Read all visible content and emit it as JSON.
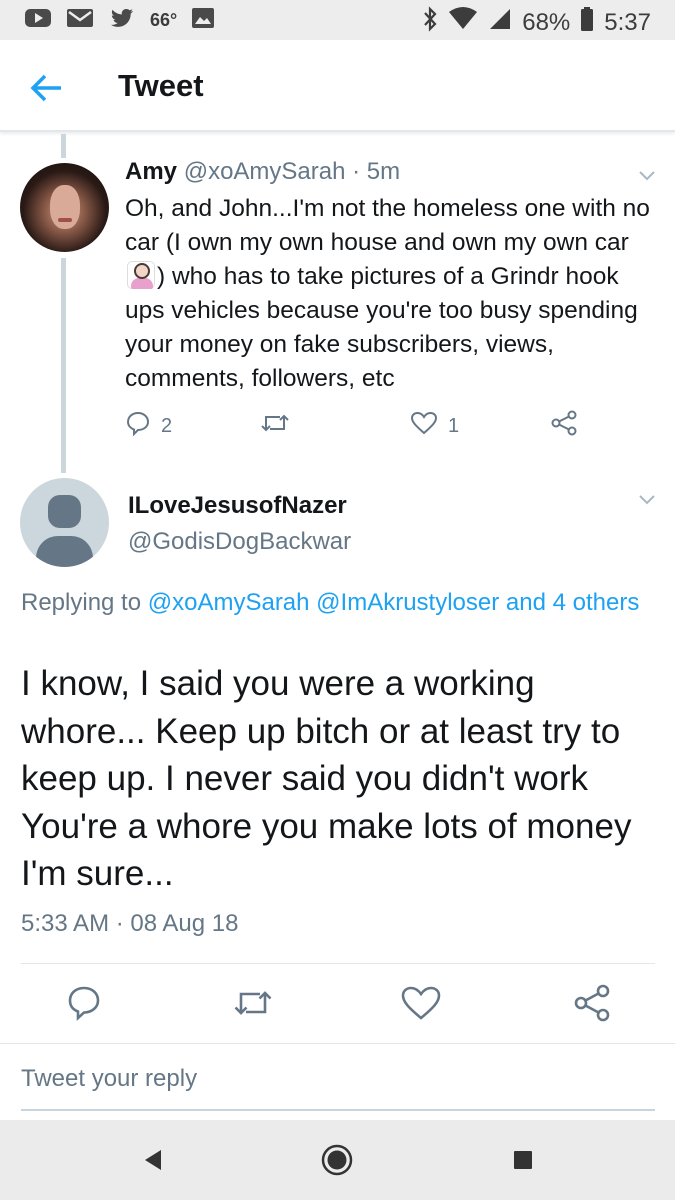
{
  "status_bar": {
    "temperature": "66°",
    "battery": "68%",
    "time": "5:37",
    "left_icons": [
      "youtube-icon",
      "gmail-icon",
      "twitter-icon",
      "image-icon"
    ],
    "right_icons": [
      "bluetooth-icon",
      "wifi-icon",
      "signal-icon",
      "battery-icon"
    ]
  },
  "app_bar": {
    "title": "Tweet"
  },
  "parent_tweet": {
    "name": "Amy",
    "handle": "@xoAmySarah",
    "time": "· 5m",
    "text_before_emoji": "Oh, and John...I'm not the homeless one with no car (I own my own house and own my own car ",
    "text_after_emoji": ") who has to take pictures of a Grindr hook ups vehicles because you're too busy spending your money on fake subscribers, views, comments, followers, etc",
    "replies": "2",
    "likes": "1"
  },
  "main_tweet": {
    "name": "ILoveJesusofNazer",
    "handle": "@GodisDogBackwar",
    "replying_prefix": "Replying to ",
    "replying_links": "@xoAmySarah @ImAkrustyloser and 4 others",
    "text": "I know, I said you were a working whore... Keep up bitch or at least try to keep up. I never said you didn't work You're a whore you make lots of money I'm sure...",
    "timestamp": "5:33 AM · 08 Aug 18"
  },
  "reply_box": {
    "placeholder": "Tweet your reply"
  },
  "colors": {
    "accent": "#1da1f2",
    "secondary_text": "#657786",
    "primary_text": "#14171a"
  }
}
